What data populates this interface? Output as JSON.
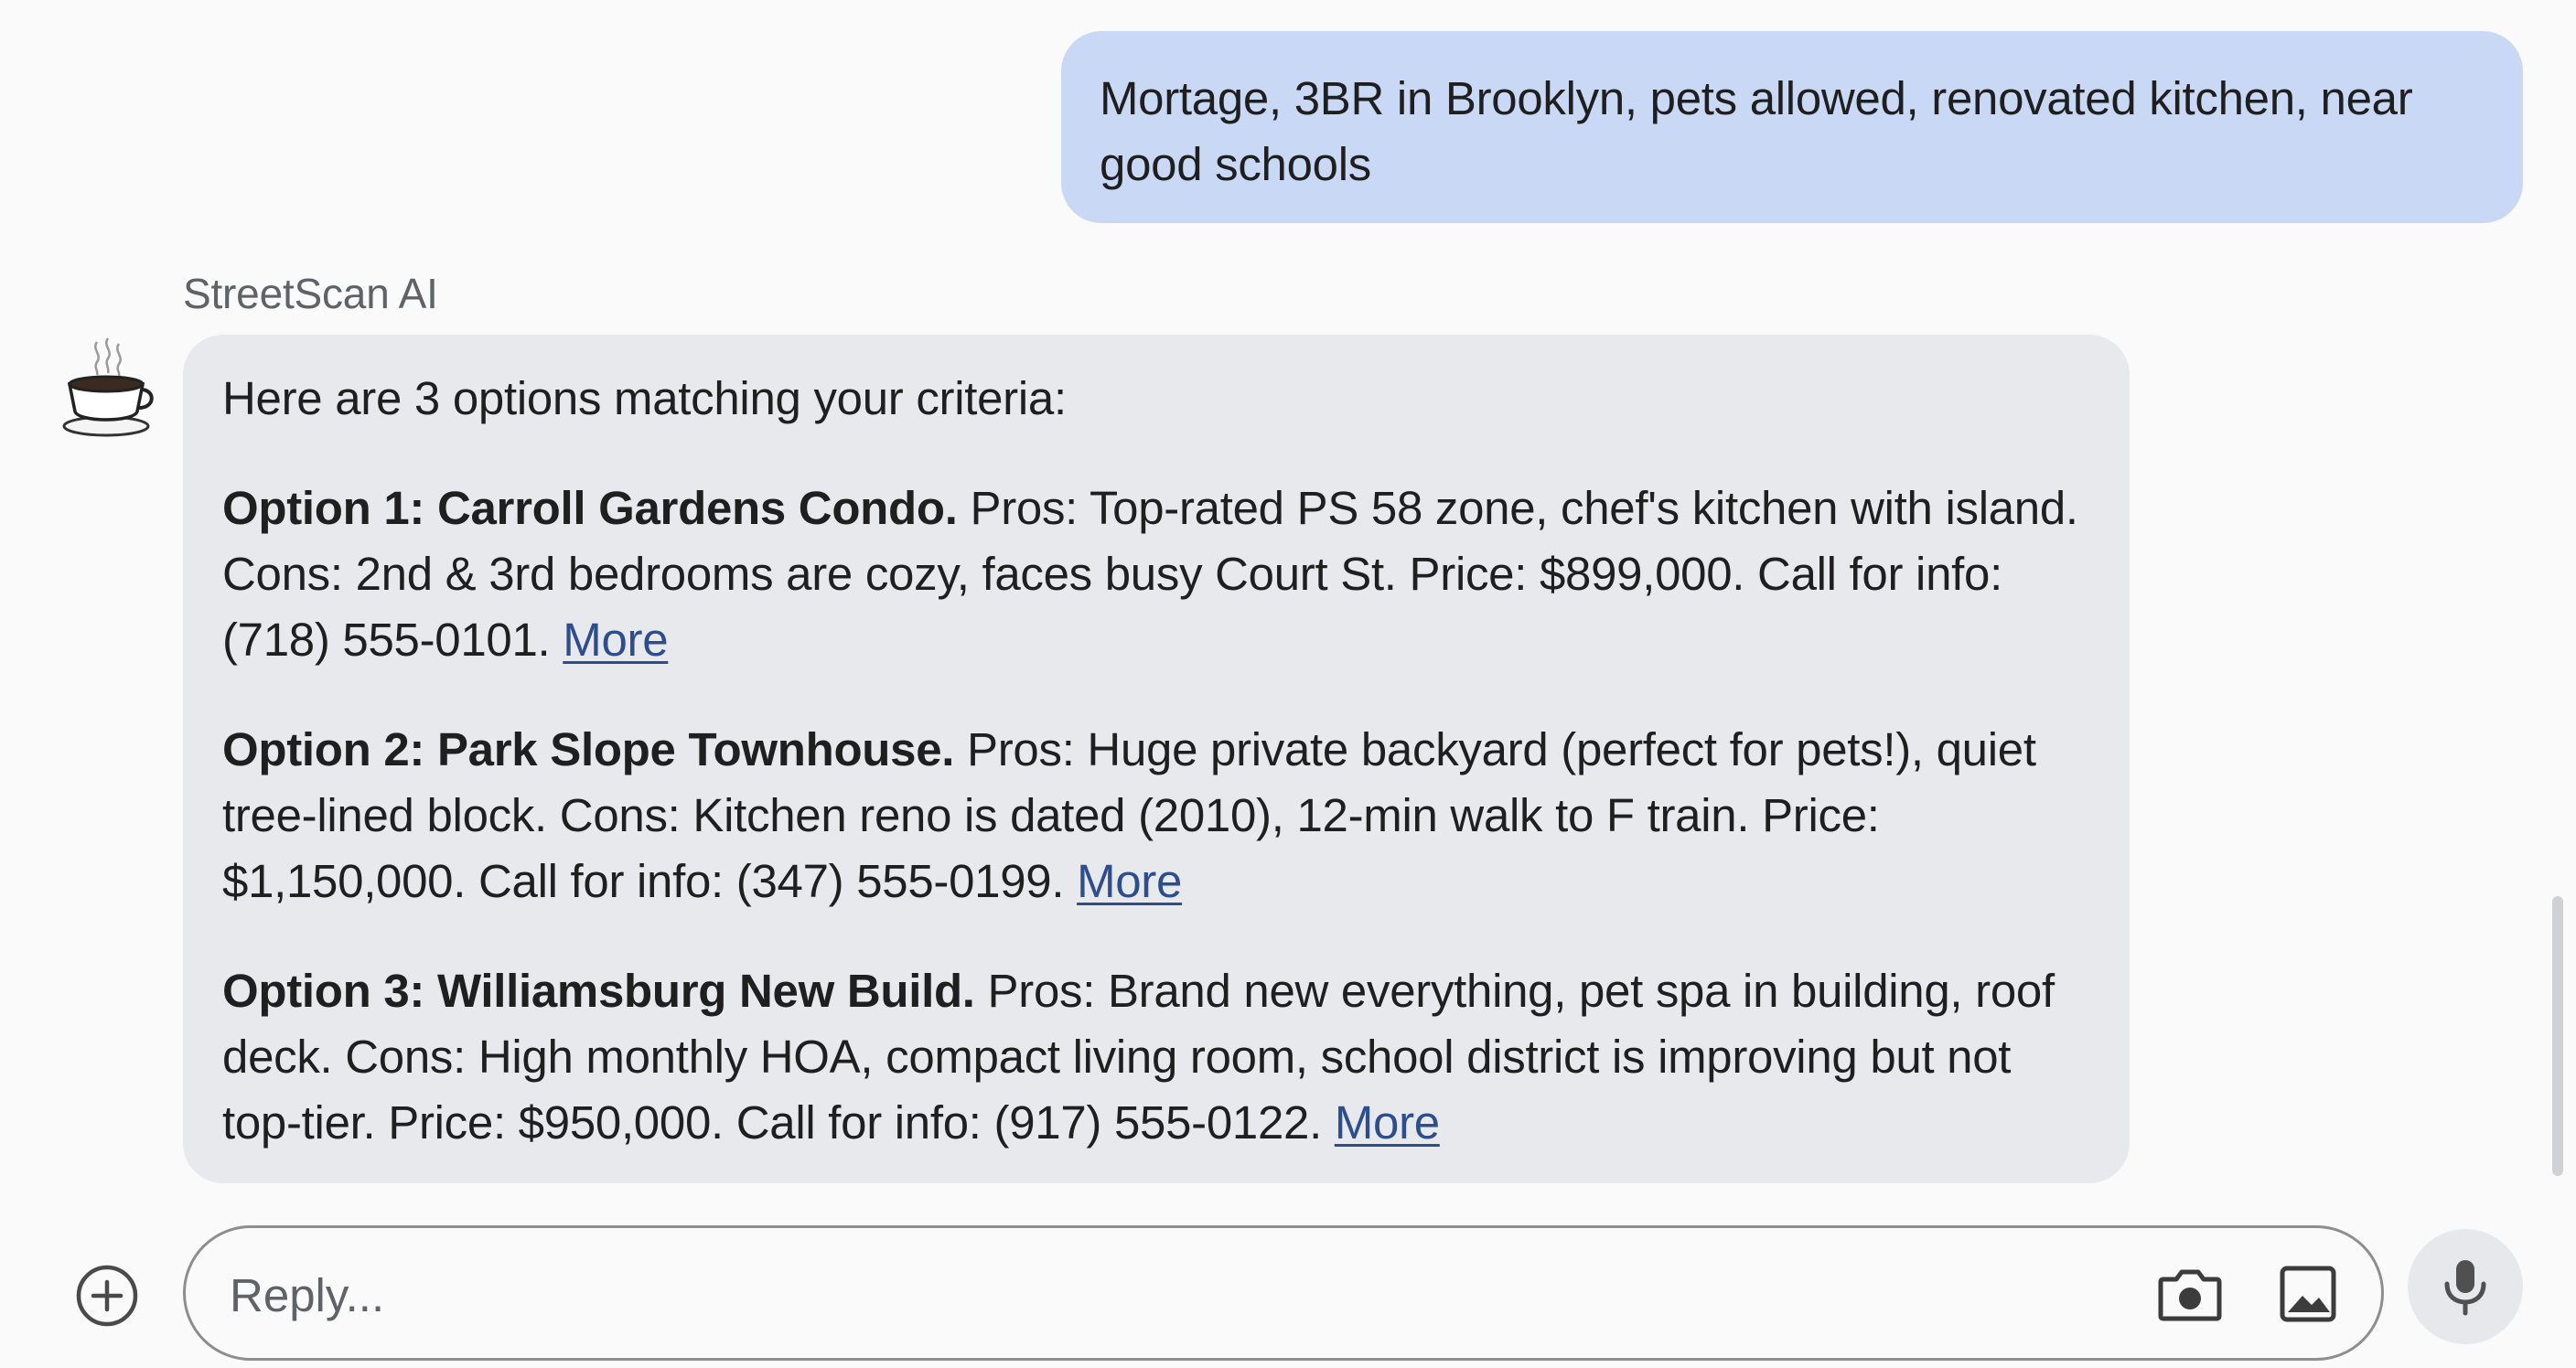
{
  "user_message": {
    "text": "Mortage, 3BR in Brooklyn, pets allowed, renovated kitchen, near good schools"
  },
  "assistant": {
    "name": "StreetScan AI",
    "avatar_icon": "coffee-cup-icon",
    "intro": "Here are 3 options matching your criteria:",
    "options": [
      {
        "title": "Option 1: Carroll Gardens Condo.",
        "body": " Pros: Top-rated PS 58 zone, chef's kitchen with island. Cons: 2nd & 3rd bedrooms are cozy, faces busy Court St. Price: $899,000. Call for info: (718) 555-0101. ",
        "link": "More"
      },
      {
        "title": "Option 2: Park Slope Townhouse.",
        "body": " Pros: Huge private backyard (perfect for pets!), quiet tree-lined block. Cons: Kitchen reno is dated (2010), 12-min walk to F train. Price: $1,150,000. Call for info: (347) 555-0199. ",
        "link": "More"
      },
      {
        "title": "Option 3: Williamsburg New Build.",
        "body": " Pros: Brand new everything, pet spa in building, roof deck. Cons: High monthly HOA, compact living room, school district is improving but not top-tier. Price: $950,000. Call for info: (917) 555-0122. ",
        "link": "More"
      }
    ]
  },
  "composer": {
    "placeholder": "Reply...",
    "icons": [
      "plus-circle-icon",
      "camera-icon",
      "image-icon",
      "microphone-icon"
    ]
  },
  "colors": {
    "user_bubble": "#c8d8f5",
    "ai_bubble": "#e7e9ec",
    "link": "#2c4e8f",
    "background": "#fafafa"
  }
}
